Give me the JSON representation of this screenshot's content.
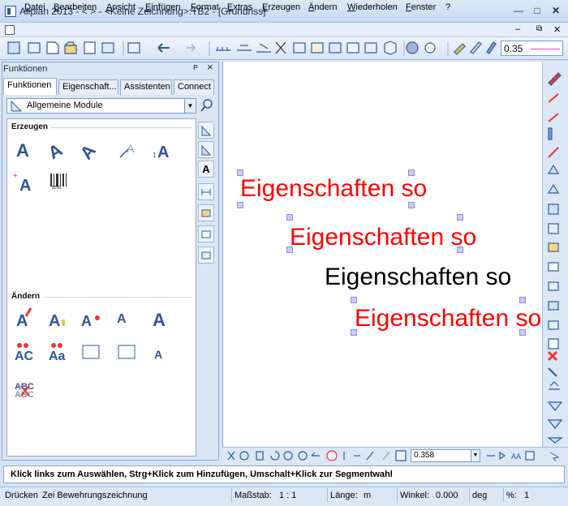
{
  "window": {
    "title": "Allplan 2013 - <   > - <Keine Zeichnung>:TB2 - [Grundriss]",
    "controls": [
      "minimize-icon",
      "maximize-icon",
      "close-icon"
    ]
  },
  "menu": {
    "items": [
      "Datei",
      "Bearbeiten",
      "Ansicht",
      "Einfügen",
      "Format",
      "Extras",
      "Erzeugen",
      "Ändern",
      "Wiederholen",
      "Fenster",
      "?"
    ]
  },
  "toolbar": {
    "pen_thickness": "0.35",
    "accent_color": "#ff3fa8"
  },
  "panel": {
    "title": "Funktionen",
    "pin_label": "ᴘ",
    "close_label": "×",
    "tabs": [
      "Funktionen",
      "Eigenschaft...",
      "Assistenten",
      "Connect"
    ],
    "module": "Allgemeine Module",
    "sections": {
      "create": "Erzeugen",
      "modify": "Ändern"
    },
    "create_tools": [
      "text-horizontal-icon",
      "text-vertical-icon",
      "text-angle-icon",
      "text-leader-icon",
      "text-index-icon",
      "text-point-icon",
      "barcode-text-icon"
    ],
    "modify_tools": [
      "modify-text-icon",
      "text-color-icon",
      "text-param-icon",
      "text-mirror-icon",
      "text-convert-icon",
      "uppercase-icon",
      "case-convert-icon",
      "text-block-delete-icon",
      "text-block-edit-icon",
      "text-align-icon",
      "spell-check-icon"
    ],
    "barcode_caption": "text",
    "tool_labels": {
      "A": "A",
      "i1": "1",
      "AC": "AC",
      "Aa": "Aa",
      "ABC": "ABC"
    }
  },
  "drawing": {
    "texts": [
      {
        "label": "Eigenschaften so",
        "color": "#ff0000"
      },
      {
        "label": "Eigenschaften so",
        "color": "#ff0000"
      },
      {
        "label": "Eigenschaften so",
        "color": "#000000"
      },
      {
        "label": "Eigenschaften so",
        "color": "#ff0000"
      }
    ]
  },
  "bottom": {
    "zoom_value": "0.358"
  },
  "hint": "Klick links zum Auswählen, Strg+Klick zum Hinzufügen, Umschalt+Klick zur Segmentwahl",
  "status": {
    "mode": "Drücken",
    "drawing": "Zei Bewehrungszeichnung",
    "scale_label": "Maßstab:",
    "scale_value": "1 : 1",
    "length_label": "Länge:",
    "length_unit": "m",
    "angle_label": "Winkel:",
    "angle_value": "0.000",
    "angle_unit": "deg",
    "percent_label": "%:",
    "percent_value": "1"
  }
}
